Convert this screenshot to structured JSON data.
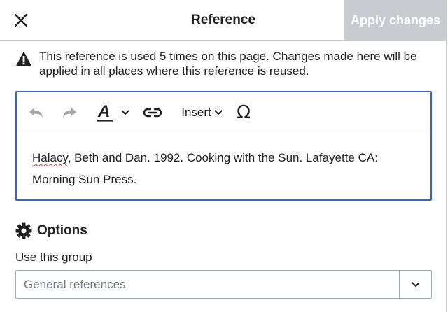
{
  "header": {
    "title": "Reference",
    "apply_label": "Apply changes"
  },
  "warning": {
    "text": "This reference is used 5 times on this page. Changes made here will be applied in all places where this reference is reused."
  },
  "toolbar": {
    "insert_label": "Insert",
    "special_char_glyph": "Ω"
  },
  "editor": {
    "misspelled_word": "Halacy",
    "content_rest": ", Beth and Dan. 1992. Cooking with the Sun. Lafayette CA: Morning Sun Press."
  },
  "options": {
    "heading": "Options",
    "group_label": "Use this group",
    "group_placeholder": "General references"
  },
  "icons": {
    "close": "close-icon",
    "warning": "warning-icon",
    "undo": "undo-icon",
    "redo": "redo-icon",
    "text_style": "text-style-icon",
    "link": "link-icon",
    "special_character": "special-character-icon",
    "options": "gear-icon",
    "dropdown": "chevron-down-icon"
  },
  "colors": {
    "accent": "#3366cc",
    "disabled_button": "#c8ccd1",
    "spellcheck": "#dd3333"
  }
}
